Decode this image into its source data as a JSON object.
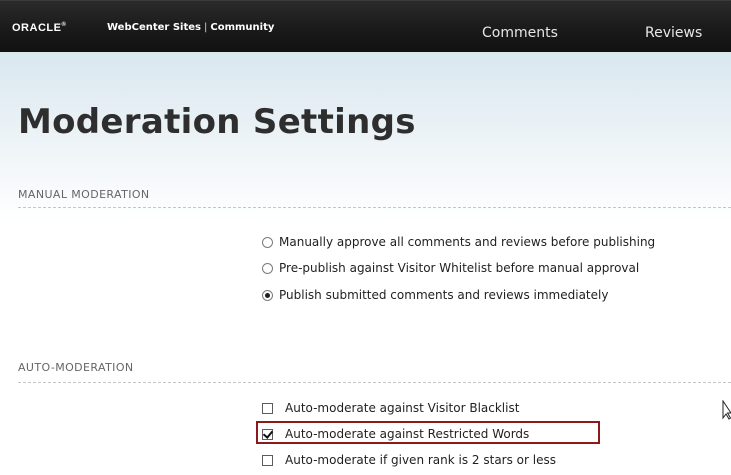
{
  "header": {
    "logo": "ORACLE",
    "logo_mark": "®",
    "product": "WebCenter Sites",
    "separator": "|",
    "section": "Community",
    "nav": [
      {
        "label": "Comments"
      },
      {
        "label": "Reviews"
      }
    ]
  },
  "page": {
    "title": "Moderation Settings"
  },
  "manual_moderation": {
    "title": "MANUAL MODERATION",
    "options": [
      {
        "label": "Manually approve all comments and reviews before publishing",
        "selected": false
      },
      {
        "label": "Pre-publish against Visitor Whitelist before manual approval",
        "selected": false
      },
      {
        "label": "Publish submitted comments and reviews immediately",
        "selected": true
      }
    ]
  },
  "auto_moderation": {
    "title": "AUTO-MODERATION",
    "options": [
      {
        "label": "Auto-moderate against Visitor Blacklist",
        "checked": false
      },
      {
        "label": "Auto-moderate against Restricted Words",
        "checked": true
      },
      {
        "label": "Auto-moderate if given rank is 2 stars or less",
        "checked": false
      }
    ]
  },
  "colors": {
    "highlight_border": "#8c1a1a",
    "topbar": "#1a1a1a"
  },
  "icons": {
    "cursor": "text-cursor-icon"
  }
}
